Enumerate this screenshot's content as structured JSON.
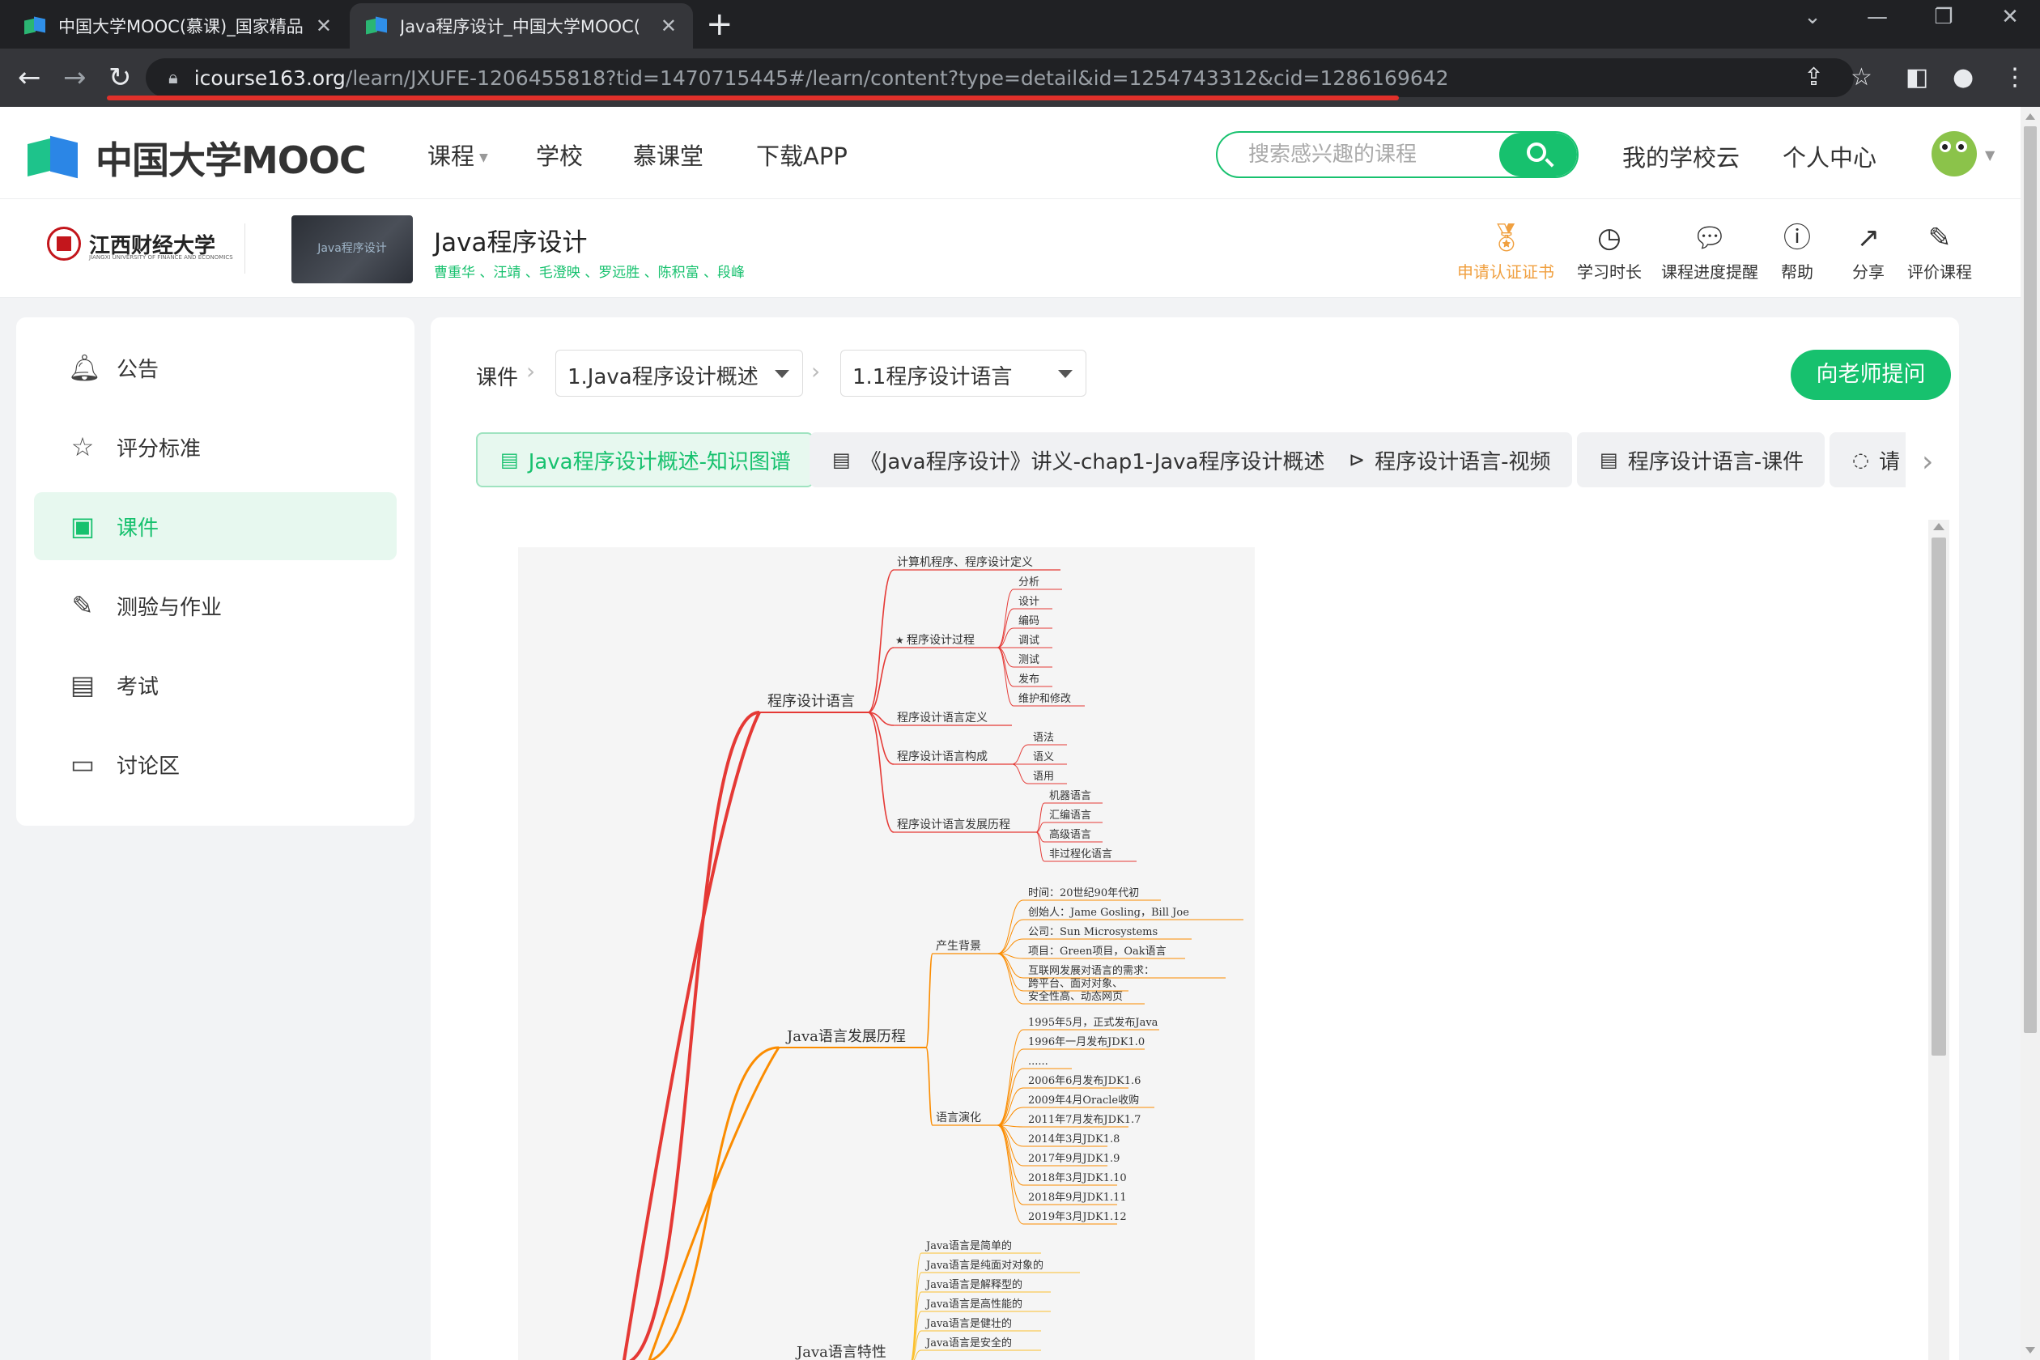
{
  "browser": {
    "tabs": [
      {
        "title": "中国大学MOOC(慕课)_国家精品",
        "active": false
      },
      {
        "title": "Java程序设计_中国大学MOOC(",
        "active": true
      }
    ],
    "new_tab_icon": "plus-icon",
    "url_host": "icourse163.org",
    "url_path": "/learn/JXUFE-1206455818?tid=1470715445#/learn/content?type=detail&id=1254743312&cid=1286169642"
  },
  "site": {
    "logo_text": "中国大学MOOC",
    "nav": [
      "课程",
      "学校",
      "慕课堂",
      "下载APP"
    ],
    "search_placeholder": "搜索感兴趣的课程",
    "school_cloud": "我的学校云",
    "personal_center": "个人中心"
  },
  "course": {
    "university": "江西财经大学",
    "university_en": "JIANGXI UNIVERSITY OF FINANCE AND ECONOMICS",
    "thumb_text": "Java程序设计",
    "title": "Java程序设计",
    "teachers": "曹重华 、汪靖 、毛澄映 、罗远胜 、陈积富 、段峰",
    "actions": [
      {
        "label": "申请认证证书",
        "icon": "certificate-icon"
      },
      {
        "label": "学习时长",
        "icon": "clock-icon"
      },
      {
        "label": "课程进度提醒",
        "icon": "wechat-icon"
      },
      {
        "label": "帮助",
        "icon": "help-icon"
      },
      {
        "label": "分享",
        "icon": "share-icon"
      },
      {
        "label": "评价课程",
        "icon": "review-icon"
      }
    ]
  },
  "sidebar": {
    "items": [
      {
        "label": "公告",
        "icon": "bell-icon"
      },
      {
        "label": "评分标准",
        "icon": "star-icon"
      },
      {
        "label": "课件",
        "icon": "courseware-icon",
        "active": true
      },
      {
        "label": "测验与作业",
        "icon": "edit-icon"
      },
      {
        "label": "考试",
        "icon": "exam-icon"
      },
      {
        "label": "讨论区",
        "icon": "discussion-icon"
      }
    ]
  },
  "content": {
    "crumb_label": "课件",
    "chapter_select": "1.Java程序设计概述",
    "section_select": "1.1程序设计语言",
    "ask_button": "向老师提问",
    "unit_tabs": [
      {
        "label": "Java程序设计概述-知识图谱",
        "icon": "document-icon",
        "active": true
      },
      {
        "label": "《Java程序设计》讲义-chap1-Java程序设计概述",
        "icon": "document-icon"
      },
      {
        "label": "程序设计语言-视频",
        "icon": "video-icon"
      },
      {
        "label": "程序设计语言-课件",
        "icon": "document-icon"
      },
      {
        "label": "请",
        "icon": "discussion-icon"
      }
    ]
  },
  "mindmap": {
    "branches": [
      {
        "label": "程序设计语言",
        "color": "#e53935",
        "children": [
          {
            "label": "计算机程序、程序设计定义",
            "items": []
          },
          {
            "label": "★程序设计过程",
            "items": [
              "分析",
              "设计",
              "编码",
              "调试",
              "测试",
              "发布",
              "维护和修改"
            ]
          },
          {
            "label": "程序设计语言定义",
            "items": []
          },
          {
            "label": "程序设计语言构成",
            "items": [
              "语法",
              "语义",
              "语用"
            ]
          },
          {
            "label": "程序设计语言发展历程",
            "items": [
              "机器语言",
              "汇编语言",
              "高级语言",
              "非过程化语言"
            ]
          }
        ]
      },
      {
        "label": "Java语言发展历程",
        "color": "#fb8c00",
        "children": [
          {
            "label": "产生背景",
            "items": [
              "时间：20世纪90年代初",
              "创始人：Jame Gosling，Bill Joe",
              "公司：Sun Microsystems",
              "项目：Green项目，Oak语言",
              "互联网发展对语言的需求：",
              "跨平台、面对对象、",
              "安全性高、动态网页"
            ]
          },
          {
            "label": "语言演化",
            "items": [
              "1995年5月，正式发布Java",
              "1996年一月发布JDK1.0",
              "......",
              "2006年6月发布JDK1.6",
              "2009年4月Oracle收购",
              "2011年7月发布JDK1.7",
              "2014年3月JDK1.8",
              "2017年9月JDK1.9",
              "2018年3月JDK1.10",
              "2018年9月JDK1.11",
              "2019年3月JDK1.12"
            ]
          }
        ]
      },
      {
        "label": "Java语言特性",
        "color": "#fbc02d",
        "children": [
          {
            "label": "",
            "items": [
              "Java语言是简单的",
              "Java语言是纯面对对象的",
              "Java语言是解释型的",
              "Java语言是高性能的",
              "Java语言是健壮的",
              "Java语言是安全的"
            ]
          }
        ]
      }
    ]
  }
}
